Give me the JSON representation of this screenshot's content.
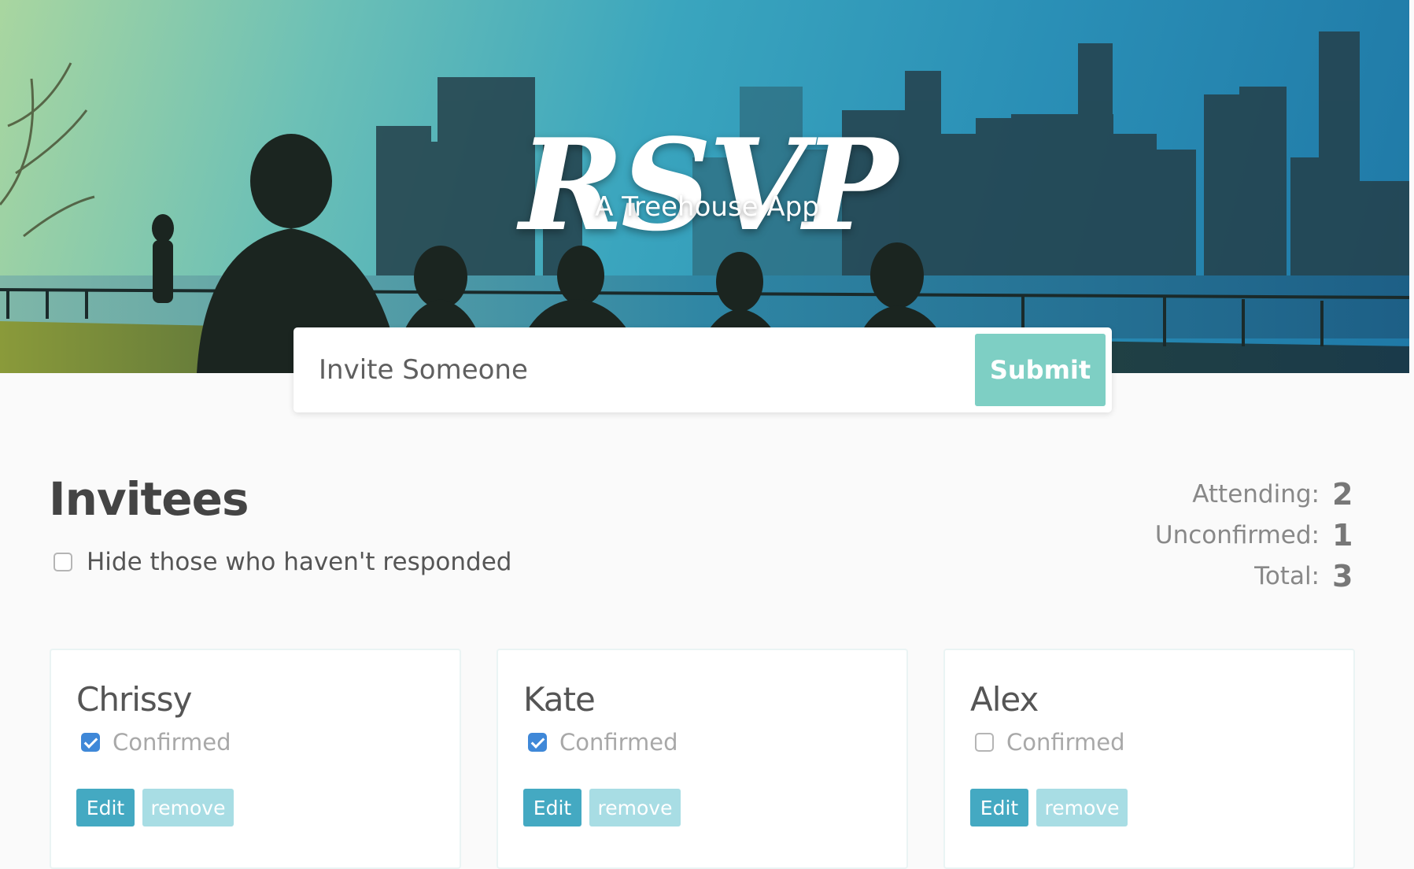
{
  "header": {
    "title": "RSVP",
    "subtitle": "A Treehouse App"
  },
  "invite_form": {
    "placeholder": "Invite Someone",
    "submit_label": "Submit"
  },
  "invitees": {
    "title": "Invitees",
    "hide_unresponded_label": "Hide those who haven't responded",
    "hide_unresponded_checked": false
  },
  "counter": {
    "attending_label": "Attending:",
    "attending_value": "2",
    "unconfirmed_label": "Unconfirmed:",
    "unconfirmed_value": "1",
    "total_label": "Total:",
    "total_value": "3"
  },
  "guests": [
    {
      "name": "Chrissy",
      "confirm_label": "Confirmed",
      "confirmed": true,
      "edit_label": "Edit",
      "remove_label": "remove"
    },
    {
      "name": "Kate",
      "confirm_label": "Confirmed",
      "confirmed": true,
      "edit_label": "Edit",
      "remove_label": "remove"
    },
    {
      "name": "Alex",
      "confirm_label": "Confirmed",
      "confirmed": false,
      "edit_label": "Edit",
      "remove_label": "remove"
    }
  ],
  "colors": {
    "accent": "#44a9c2",
    "submit": "#7ecfc4",
    "remove": "#a8dde4",
    "checkbox_checked": "#3f88d8"
  }
}
